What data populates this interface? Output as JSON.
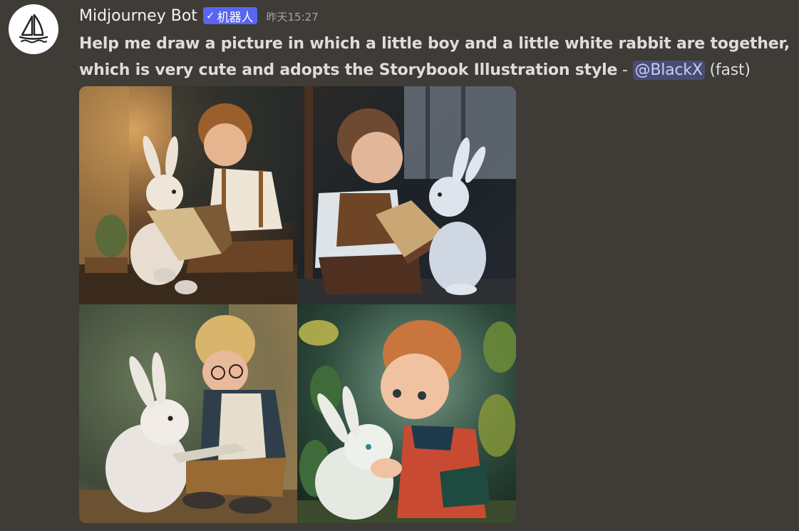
{
  "message": {
    "author": "Midjourney Bot",
    "bot_tag": {
      "check_icon": "checkmark-icon",
      "label": "机器人",
      "color": "#5865f2"
    },
    "timestamp": "昨天15:27",
    "prompt": "Help me draw a picture in which a little boy and a little white rabbit are together, which is very cute and adopts the Storybook Illustration style",
    "separator": " - ",
    "mention": "@BlackX",
    "mode": "(fast)"
  },
  "avatar": {
    "icon": "sailboat-icon"
  },
  "images": [
    {
      "icon": "image-icon"
    },
    {
      "icon": "image-icon"
    },
    {
      "icon": "image-icon"
    },
    {
      "icon": "image-icon"
    }
  ],
  "colors": {
    "background": "#3f3b36",
    "mention_bg": "#4a4d73",
    "mention_fg": "#c9cdfb"
  }
}
